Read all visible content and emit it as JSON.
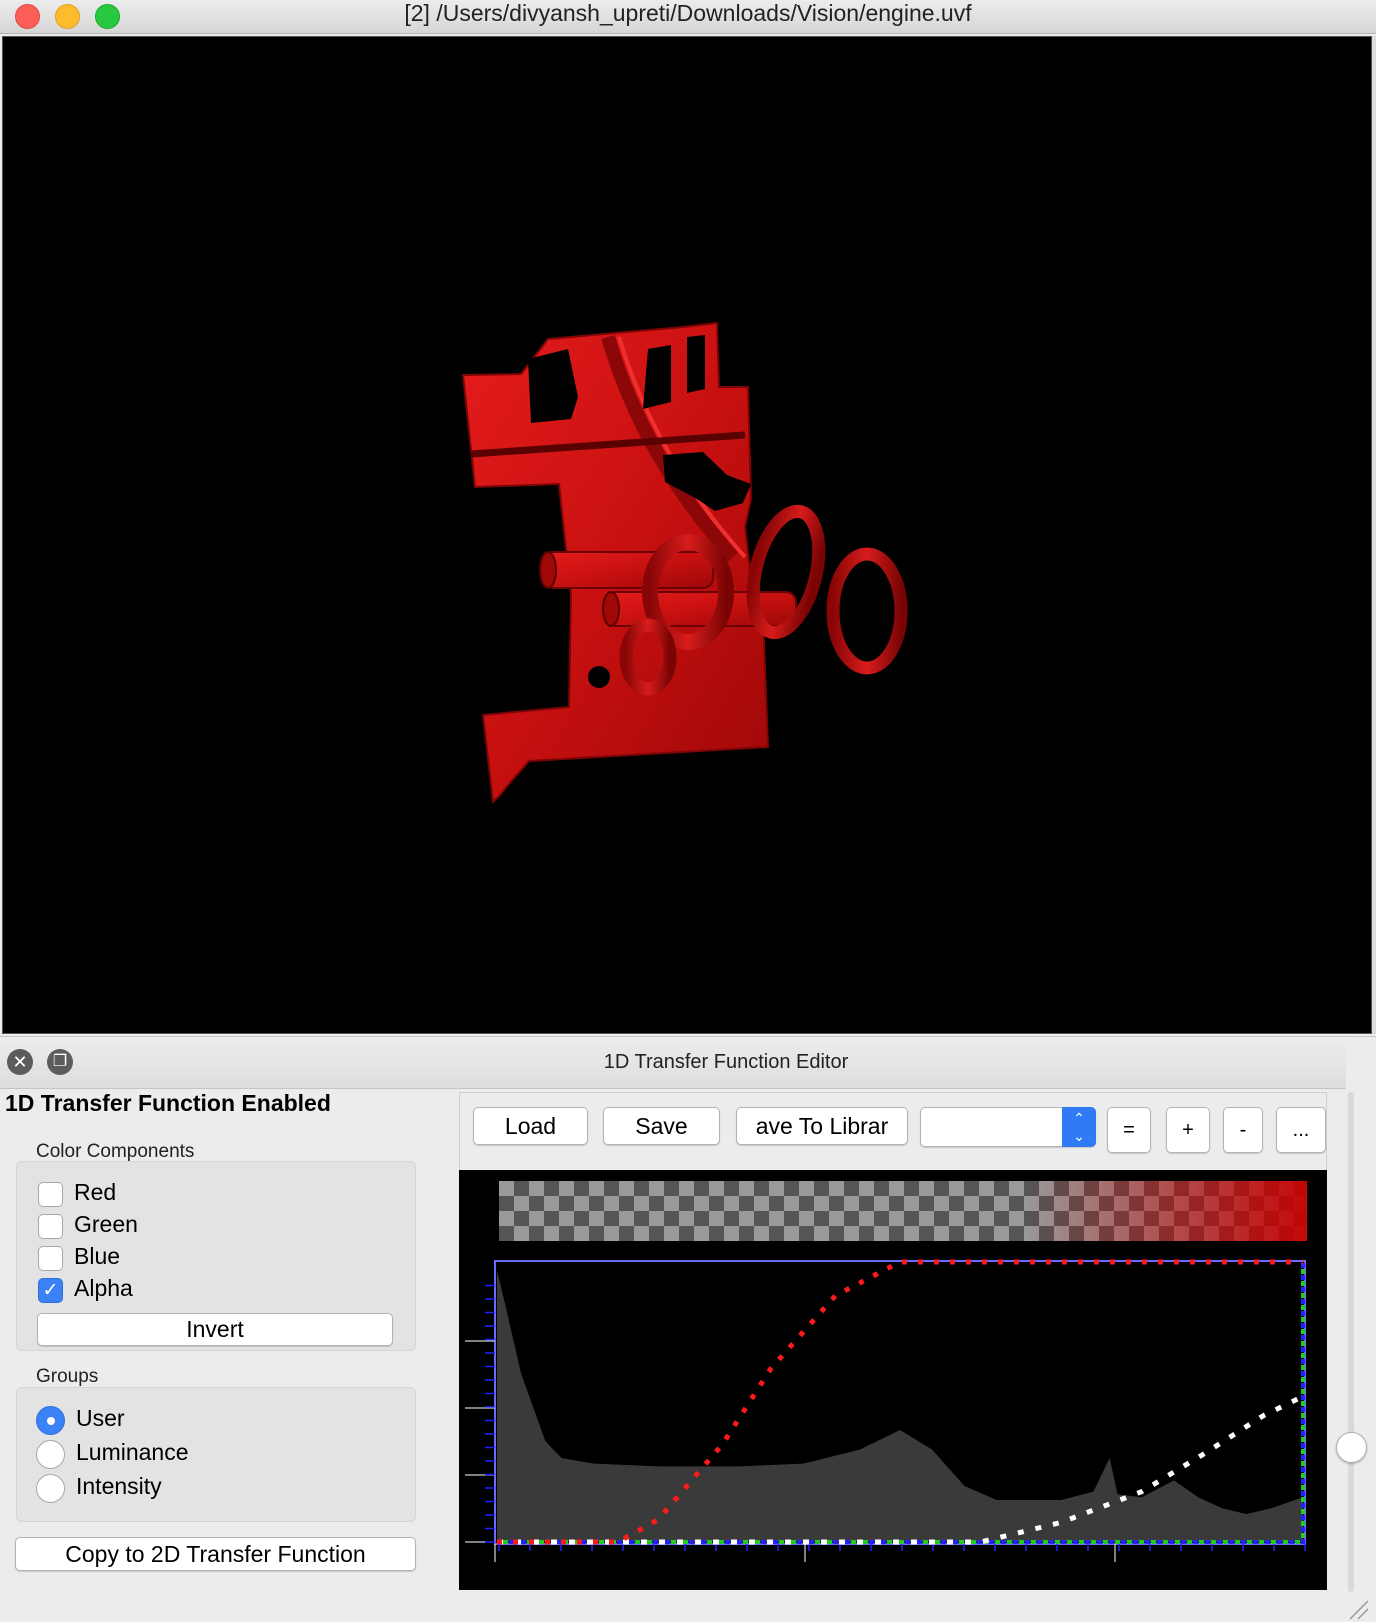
{
  "window": {
    "title": "[2] /Users/divyansh_upreti/Downloads/Vision/engine.uvf"
  },
  "render_view": {
    "background": "#000000",
    "object_color": "#d41414"
  },
  "tf_editor": {
    "title": "1D Transfer Function Editor",
    "close_icon": "close-icon",
    "detach_icon": "detach-icon",
    "enabled_label": "1D Transfer Function Enabled",
    "color_components": {
      "label": "Color Components",
      "items": [
        {
          "label": "Red",
          "checked": false
        },
        {
          "label": "Green",
          "checked": false
        },
        {
          "label": "Blue",
          "checked": false
        },
        {
          "label": "Alpha",
          "checked": true
        }
      ],
      "invert_label": "Invert"
    },
    "groups": {
      "label": "Groups",
      "items": [
        {
          "label": "User",
          "selected": true
        },
        {
          "label": "Luminance",
          "selected": false
        },
        {
          "label": "Intensity",
          "selected": false
        }
      ]
    },
    "copy_label": "Copy to 2D Transfer Function",
    "toolbar": {
      "load_label": "Load",
      "save_label": "Save",
      "save_library_label": "ave To Librar",
      "library_value": "",
      "equal_label": "=",
      "plus_label": "+",
      "minus_label": "-",
      "more_label": "..."
    },
    "colors": {
      "red_curve": "#ff1a1a",
      "alpha_curve": "#ffffff",
      "green_curve": "#22cc22",
      "blue_curve": "#2222ff",
      "histogram": "#3a3a3a",
      "accent": "#3b82f6"
    }
  }
}
